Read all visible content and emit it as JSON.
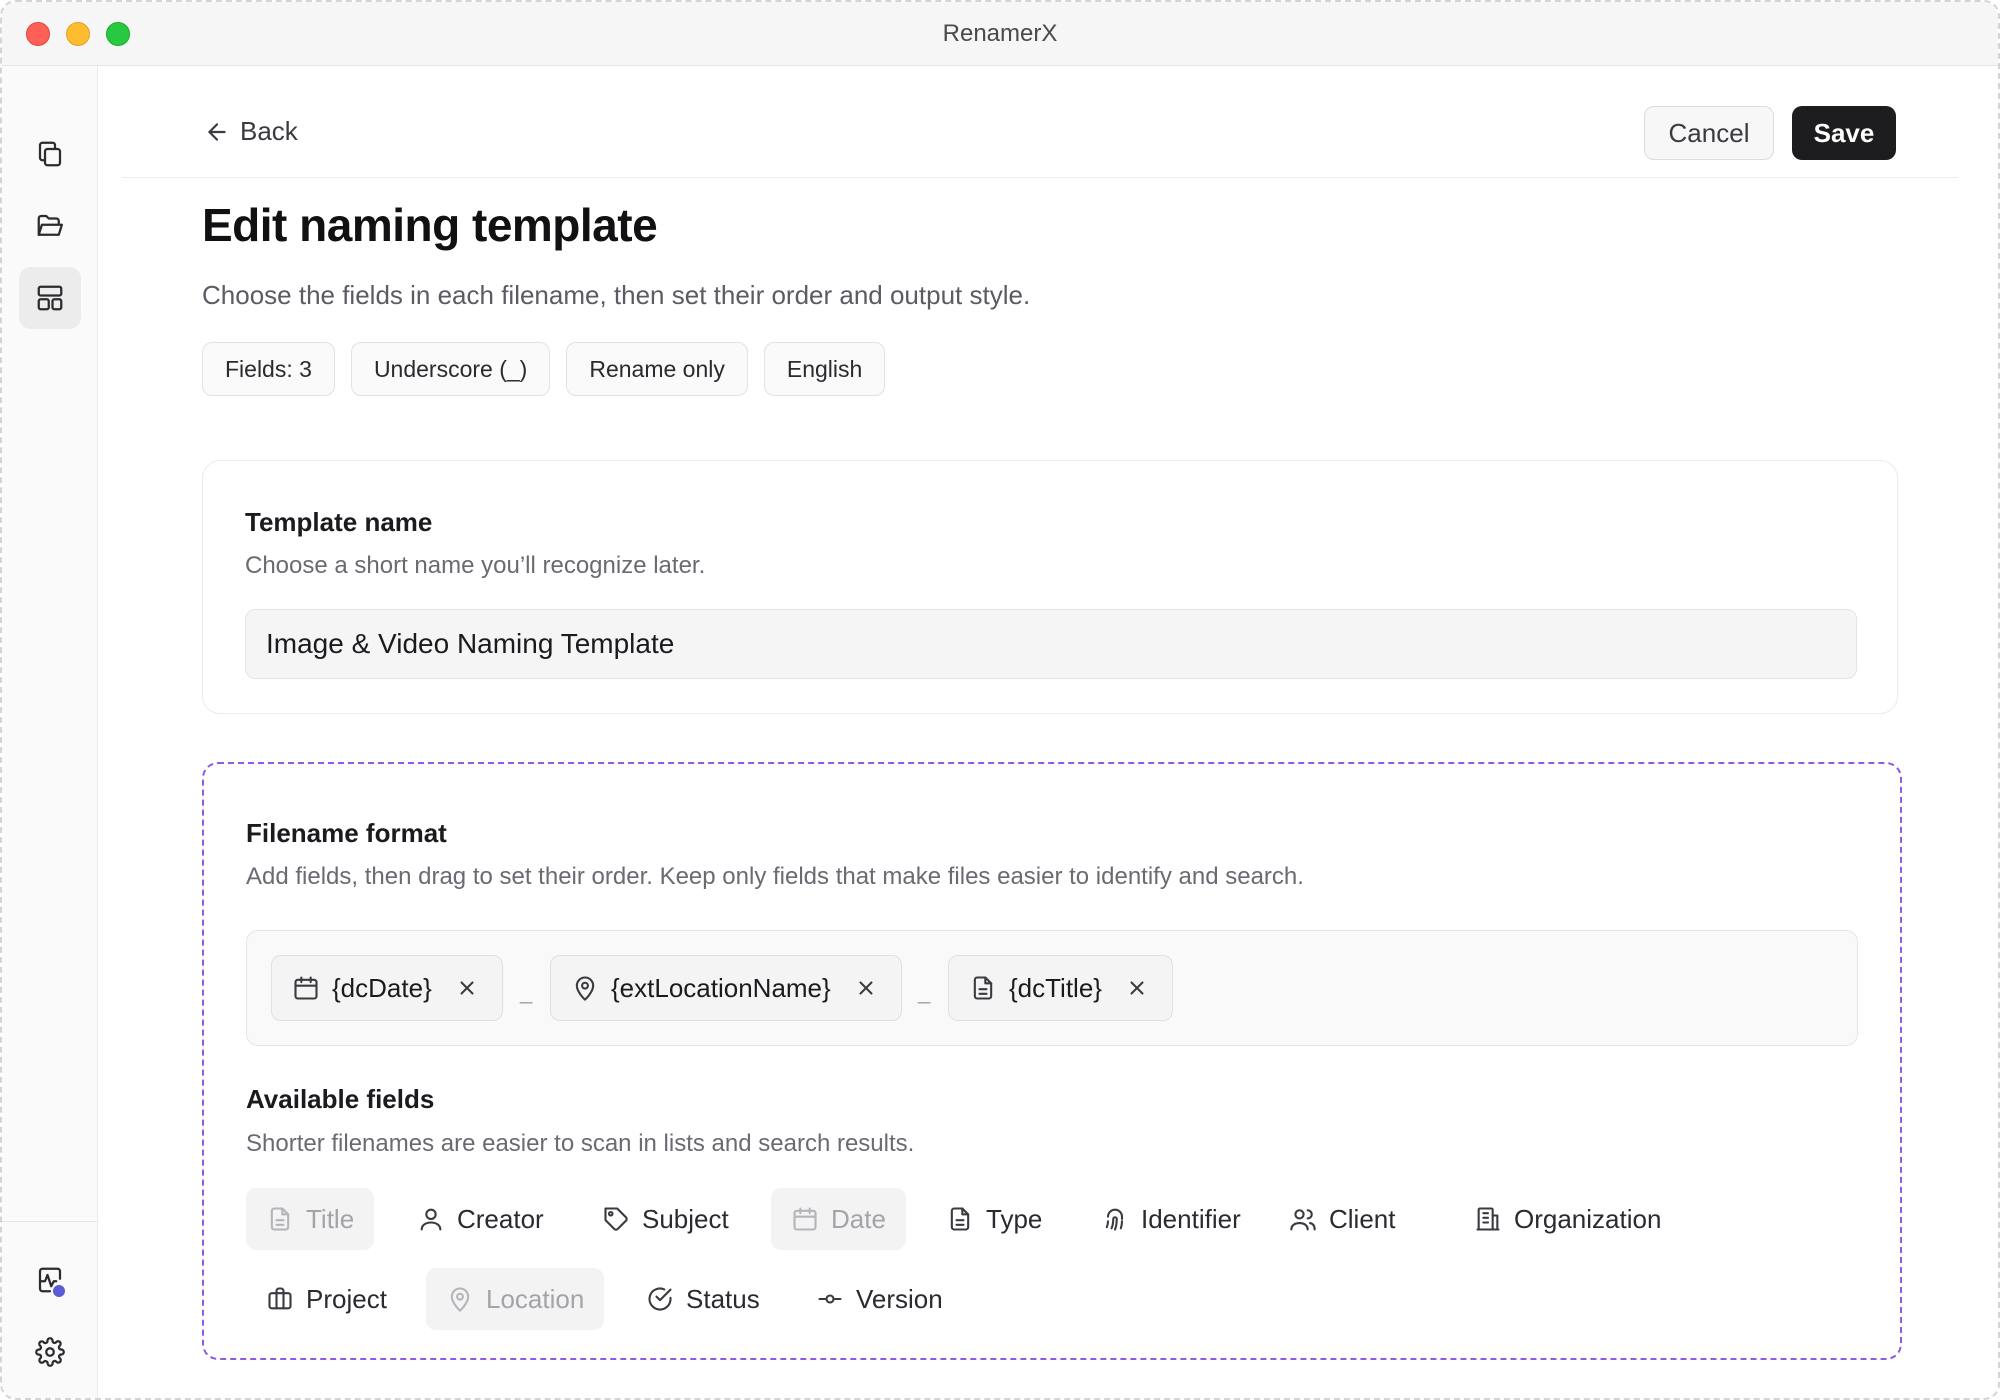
{
  "window": {
    "title": "RenamerX"
  },
  "header": {
    "back_label": "Back",
    "cancel_label": "Cancel",
    "save_label": "Save"
  },
  "page": {
    "title": "Edit naming template",
    "subtitle": "Choose the fields in each filename, then set their order and output style."
  },
  "chips": [
    "Fields: 3",
    "Underscore (_)",
    "Rename only",
    "English"
  ],
  "template_name": {
    "title": "Template name",
    "description": "Choose a short name you’ll recognize later.",
    "value": "Image & Video Naming Template"
  },
  "filename_format": {
    "title": "Filename format",
    "description": "Add fields, then drag to set their order. Keep only fields that make files easier to identify and search.",
    "separator": "_",
    "tokens": [
      {
        "label": "{dcDate}",
        "icon": "calendar-icon"
      },
      {
        "label": "{extLocationName}",
        "icon": "map-pin-icon"
      },
      {
        "label": "{dcTitle}",
        "icon": "document-icon"
      }
    ]
  },
  "available_fields": {
    "title": "Available fields",
    "description": "Shorter filenames are easier to scan in lists and search results.",
    "items": [
      {
        "label": "Title",
        "icon": "document-icon",
        "disabled": true
      },
      {
        "label": "Creator",
        "icon": "user-icon",
        "disabled": false
      },
      {
        "label": "Subject",
        "icon": "tag-icon",
        "disabled": false
      },
      {
        "label": "Date",
        "icon": "calendar-icon",
        "disabled": true
      },
      {
        "label": "Type",
        "icon": "document-icon",
        "disabled": false
      },
      {
        "label": "Identifier",
        "icon": "fingerprint-icon",
        "disabled": false
      },
      {
        "label": "Client",
        "icon": "users-icon",
        "disabled": false
      },
      {
        "label": "Organization",
        "icon": "building-icon",
        "disabled": false
      },
      {
        "label": "Project",
        "icon": "briefcase-icon",
        "disabled": false
      },
      {
        "label": "Location",
        "icon": "map-pin-icon",
        "disabled": true
      },
      {
        "label": "Status",
        "icon": "check-circle-icon",
        "disabled": false
      },
      {
        "label": "Version",
        "icon": "commit-icon",
        "disabled": false
      }
    ]
  },
  "sidebar": {
    "items": [
      "copy-files-icon",
      "folder-open-icon",
      "layout-template-icon"
    ],
    "bottom_items": [
      "activity-icon",
      "gear-icon"
    ]
  },
  "colors": {
    "accent": "#8f5be0",
    "primary_button": "#1d1d20",
    "notification_dot": "#5b5bd6"
  }
}
